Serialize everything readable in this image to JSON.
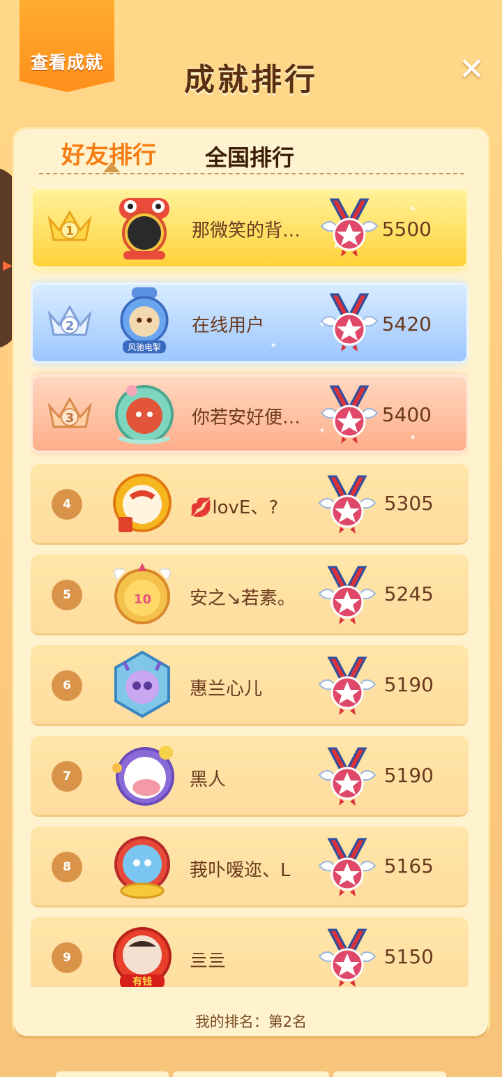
{
  "header": {
    "achievement_tab": "查看成就",
    "title": "成就排行",
    "close_icon": "close-icon"
  },
  "tabs": [
    {
      "label": "好友排行",
      "active": true
    },
    {
      "label": "全国排行",
      "active": false
    }
  ],
  "colors": {
    "accent": "#f57d12",
    "rank1": "#ffd23a",
    "rank2": "#9cc6ff",
    "rank3": "#ffae8a",
    "row": "#ffe6a8"
  },
  "rows": [
    {
      "rank": "1",
      "name": "那微笑的背…",
      "score": "5500"
    },
    {
      "rank": "2",
      "name": "在线用户",
      "score": "5420"
    },
    {
      "rank": "3",
      "name": "你若安好便…",
      "score": "5400"
    },
    {
      "rank": "4",
      "name": "💋lovE、?",
      "score": "5305"
    },
    {
      "rank": "5",
      "name": "安之↘若素。",
      "score": "5245"
    },
    {
      "rank": "6",
      "name": "惠兰心儿",
      "score": "5190"
    },
    {
      "rank": "7",
      "name": "黑人",
      "score": "5190"
    },
    {
      "rank": "8",
      "name": "莪卟嗳迩、L",
      "score": "5165"
    },
    {
      "rank": "9",
      "name": "亖亖",
      "score": "5150"
    }
  ],
  "avatar_badges": {
    "rank2": "风驰电掣",
    "rank9": "有钱"
  },
  "footer": {
    "my_rank": "我的排名：第2名"
  }
}
